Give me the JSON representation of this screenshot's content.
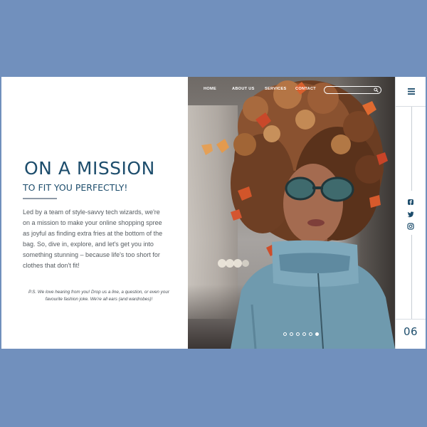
{
  "hero": {
    "title": "ON A MISSION",
    "subtitle": "TO FIT YOU PERFECTLY!",
    "body": "Led by a team of style-savvy tech wizards, we're on a mission to make your online shopping spree as joyful as finding extra fries at the bottom of the bag. So, dive in, explore, and let's get you into something stunning – because life's too short for clothes that don't fit!",
    "ps": "P.S. We love hearing from you! Drop us a line, a question, or even your favourite fashion joke. We're all ears (and wardrobes)!"
  },
  "nav": {
    "items": [
      {
        "label": "HOME"
      },
      {
        "label": "ABOUT US"
      },
      {
        "label": "SERVICES"
      },
      {
        "label": "CONTACT"
      }
    ],
    "search": {
      "placeholder": "",
      "value": ""
    }
  },
  "carousel": {
    "total": 6,
    "active": 6
  },
  "sidebar": {
    "page_number": "06",
    "social": [
      "facebook-icon",
      "twitter-icon",
      "instagram-icon"
    ]
  },
  "colors": {
    "background": "#7190bd",
    "accent": "#1d4d6c",
    "text": "#555b60"
  }
}
